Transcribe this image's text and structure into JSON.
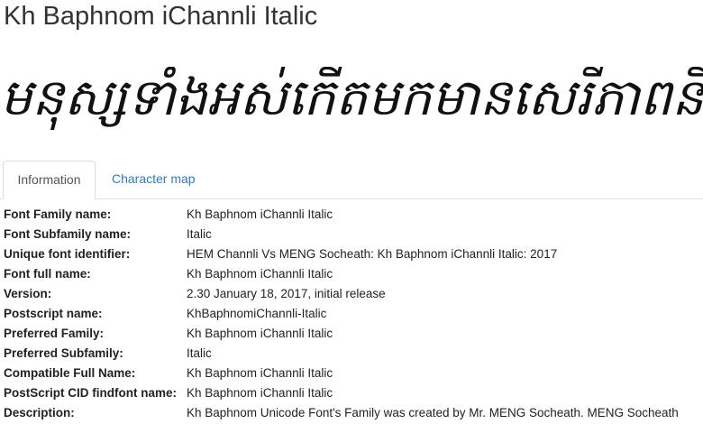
{
  "page": {
    "title": "Kh Baphnom iChannli Italic",
    "sample_text": "មនុស្សទាំងអស់កើតមកមានសេរីភាពនិងស"
  },
  "tabs": [
    {
      "label": "Information",
      "active": true
    },
    {
      "label": "Character map",
      "active": false
    }
  ],
  "info": [
    {
      "key": "Font Family name:",
      "value": "Kh Baphnom iChannli Italic"
    },
    {
      "key": "Font Subfamily name:",
      "value": "Italic"
    },
    {
      "key": "Unique font identifier:",
      "value": "HEM Channli Vs MENG Socheath: Kh Baphnom iChannli Italic: 2017"
    },
    {
      "key": "Font full name:",
      "value": "Kh Baphnom iChannli Italic"
    },
    {
      "key": "Version:",
      "value": "2.30 January 18, 2017, initial release"
    },
    {
      "key": "Postscript name:",
      "value": "KhBaphnomiChannli-Italic"
    },
    {
      "key": "Preferred Family:",
      "value": "Kh Baphnom iChannli Italic"
    },
    {
      "key": "Preferred Subfamily:",
      "value": "Italic"
    },
    {
      "key": "Compatible Full Name:",
      "value": "Kh Baphnom iChannli Italic"
    },
    {
      "key": "PostScript CID findfont name:",
      "value": "Kh Baphnom iChannli Italic"
    },
    {
      "key": "Description:",
      "value": "Kh Baphnom Unicode Font's Family was created by Mr. MENG Socheath. MENG Socheath"
    }
  ],
  "colors": {
    "link": "#337ab7",
    "text": "#333333",
    "border": "#dddddd"
  }
}
